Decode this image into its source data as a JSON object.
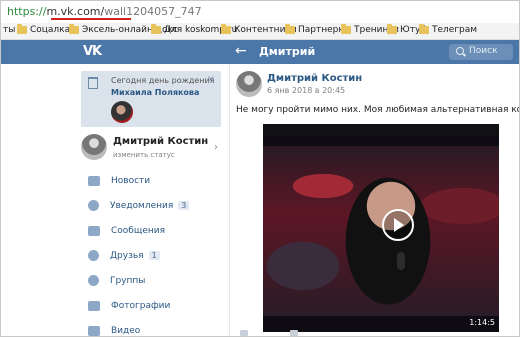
{
  "browser": {
    "url_protocol": "https://",
    "url_host": "m.vk.com/",
    "url_path": "wall1204057_747"
  },
  "bookmarks": [
    {
      "label": "ты"
    },
    {
      "label": "Соцалка"
    },
    {
      "label": "Эксель-онлайн докс"
    },
    {
      "label": "Для koskomp.ru"
    },
    {
      "label": "Контентники"
    },
    {
      "label": "Партнерки"
    },
    {
      "label": "Тренинги"
    },
    {
      "label": "Ютуб"
    },
    {
      "label": "Телеграм"
    }
  ],
  "header": {
    "logo": "VK",
    "back_glyph": "←",
    "title": "Дмитрий",
    "search_label": "Поиск",
    "accent": "#4a76a8"
  },
  "birthday": {
    "line1": "Сегодня день рождения",
    "line2": "Михаила Полякова",
    "close": "×"
  },
  "profile": {
    "name": "Дмитрий Костин",
    "status": "изменить статус",
    "chevron": "›"
  },
  "menu": [
    {
      "label": "Новости",
      "count": "",
      "icon": "news-icon"
    },
    {
      "label": "Уведомления",
      "count": "3",
      "icon": "bell-icon"
    },
    {
      "label": "Сообщения",
      "count": "",
      "icon": "message-icon"
    },
    {
      "label": "Друзья",
      "count": "1",
      "icon": "friends-icon"
    },
    {
      "label": "Группы",
      "count": "",
      "icon": "groups-icon"
    },
    {
      "label": "Фотографии",
      "count": "",
      "icon": "camera-icon"
    },
    {
      "label": "Видео",
      "count": "",
      "icon": "video-icon"
    }
  ],
  "post": {
    "author": "Дмитрий Костин",
    "date": "6 янв 2018 в 20:45",
    "text": "Не могу пройти мимо них. Моя любимая альтернативная команда",
    "video_duration": "1:14:5"
  }
}
